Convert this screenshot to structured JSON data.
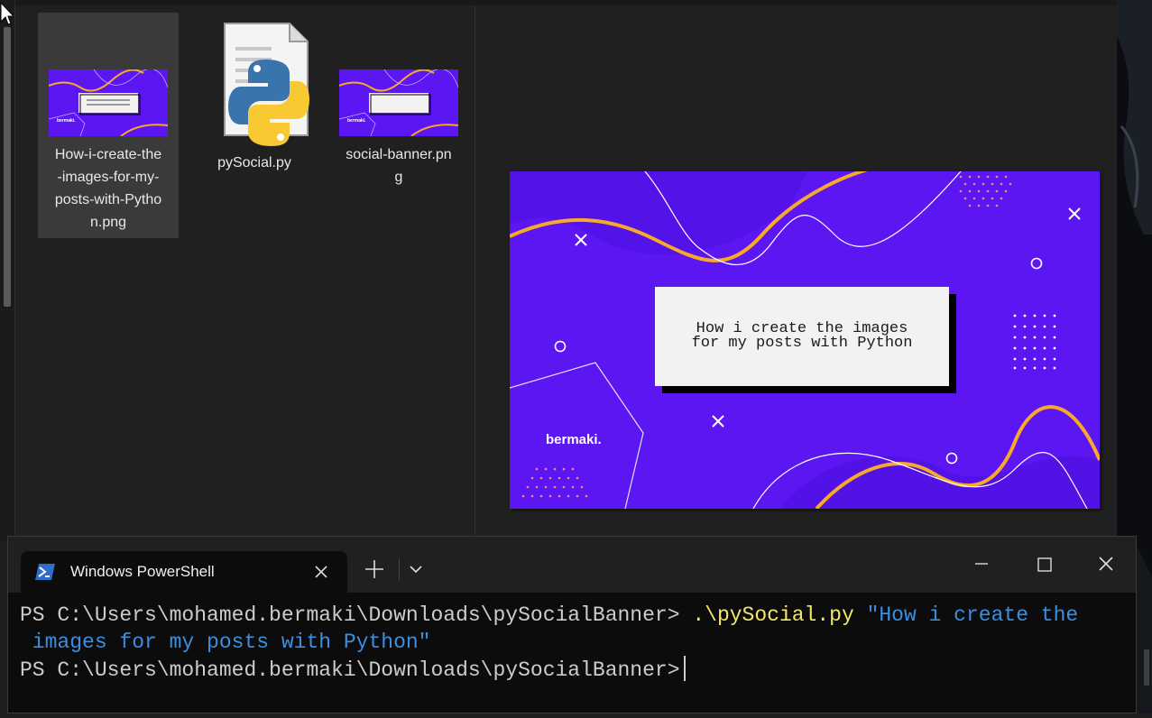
{
  "explorer": {
    "files": [
      {
        "name": "How-i-create-the-images-for-my-posts-with-Python.png",
        "label_lines": [
          "How-i-create-the",
          "-images-for-my-",
          "posts-with-Pytho",
          "n.png"
        ],
        "selected": true,
        "icon": "image-thumbnail-icon"
      },
      {
        "name": "pySocial.py",
        "label_lines": [
          "pySocial.py"
        ],
        "selected": false,
        "icon": "python-file-icon"
      },
      {
        "name": "social-banner.png",
        "label_lines": [
          "social-banner.pn",
          "g"
        ],
        "selected": false,
        "icon": "image-thumbnail-icon"
      }
    ]
  },
  "preview": {
    "title_lines": [
      "How i create the images",
      "for my posts with Python"
    ],
    "brand": "bermaki.",
    "colors": {
      "background": "#5b16f2",
      "accent": "#f7a928",
      "card": "#f2f2f2"
    }
  },
  "terminal": {
    "tab_title": "Windows PowerShell",
    "icons": {
      "tab": "powershell-icon",
      "close_tab": "close-icon",
      "new_tab": "plus-icon",
      "dropdown": "chevron-down-icon",
      "minimize": "minimize-icon",
      "maximize": "maximize-icon",
      "close": "close-icon"
    },
    "lines": [
      {
        "prompt": "PS C:\\Users\\mohamed.bermaki\\Downloads\\pySocialBanner>",
        "command": " .\\pySocial.py",
        "argument": " \"How i create the"
      },
      {
        "continuation": " images for my posts with Python\""
      },
      {
        "prompt": "PS C:\\Users\\mohamed.bermaki\\Downloads\\pySocialBanner>",
        "command": "",
        "argument": ""
      }
    ]
  }
}
